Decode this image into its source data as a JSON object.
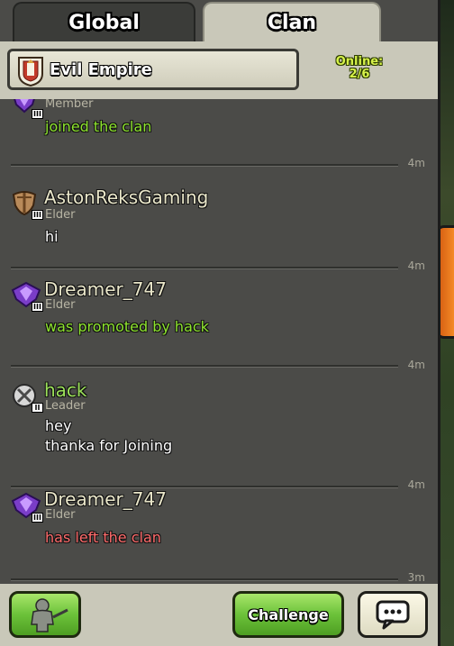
{
  "tabs": {
    "global_label": "Global",
    "clan_label": "Clan"
  },
  "header": {
    "clan_name": "Evil Empire",
    "online_label": "Online:",
    "online_count": "2/6"
  },
  "messages": [
    {
      "name": "",
      "role": "Member",
      "lines": [
        "joined the clan"
      ],
      "text_style": "green",
      "time": "4m",
      "avatar": "purple-shield-icon"
    },
    {
      "name": "AstonReksGaming",
      "role": "Elder",
      "lines": [
        "hi"
      ],
      "text_style": "white",
      "time": "4m",
      "avatar": "bronze-shield-icon"
    },
    {
      "name": "Dreamer_747",
      "role": "Elder",
      "lines": [
        "was promoted by hack"
      ],
      "text_style": "green",
      "time": "4m",
      "avatar": "purple-shield-icon"
    },
    {
      "name": "hack",
      "role": "Leader",
      "lines": [
        "hey",
        "thanka for Joining"
      ],
      "text_style": "white",
      "time": "4m",
      "avatar": "crossed-swords-icon"
    },
    {
      "name": "Dreamer_747",
      "role": "Elder",
      "lines": [
        "has left the clan"
      ],
      "text_style": "red",
      "time": "3m",
      "avatar": "purple-shield-icon"
    }
  ],
  "footer": {
    "challenge_label": "Challenge"
  },
  "colors": {
    "panel": "#4b4b48",
    "header": "#c9c8b9",
    "green_text": "#8ee42e",
    "red_text": "#ff6b6b",
    "leader_name": "#9ce15a",
    "online_text": "#d6f24a"
  }
}
